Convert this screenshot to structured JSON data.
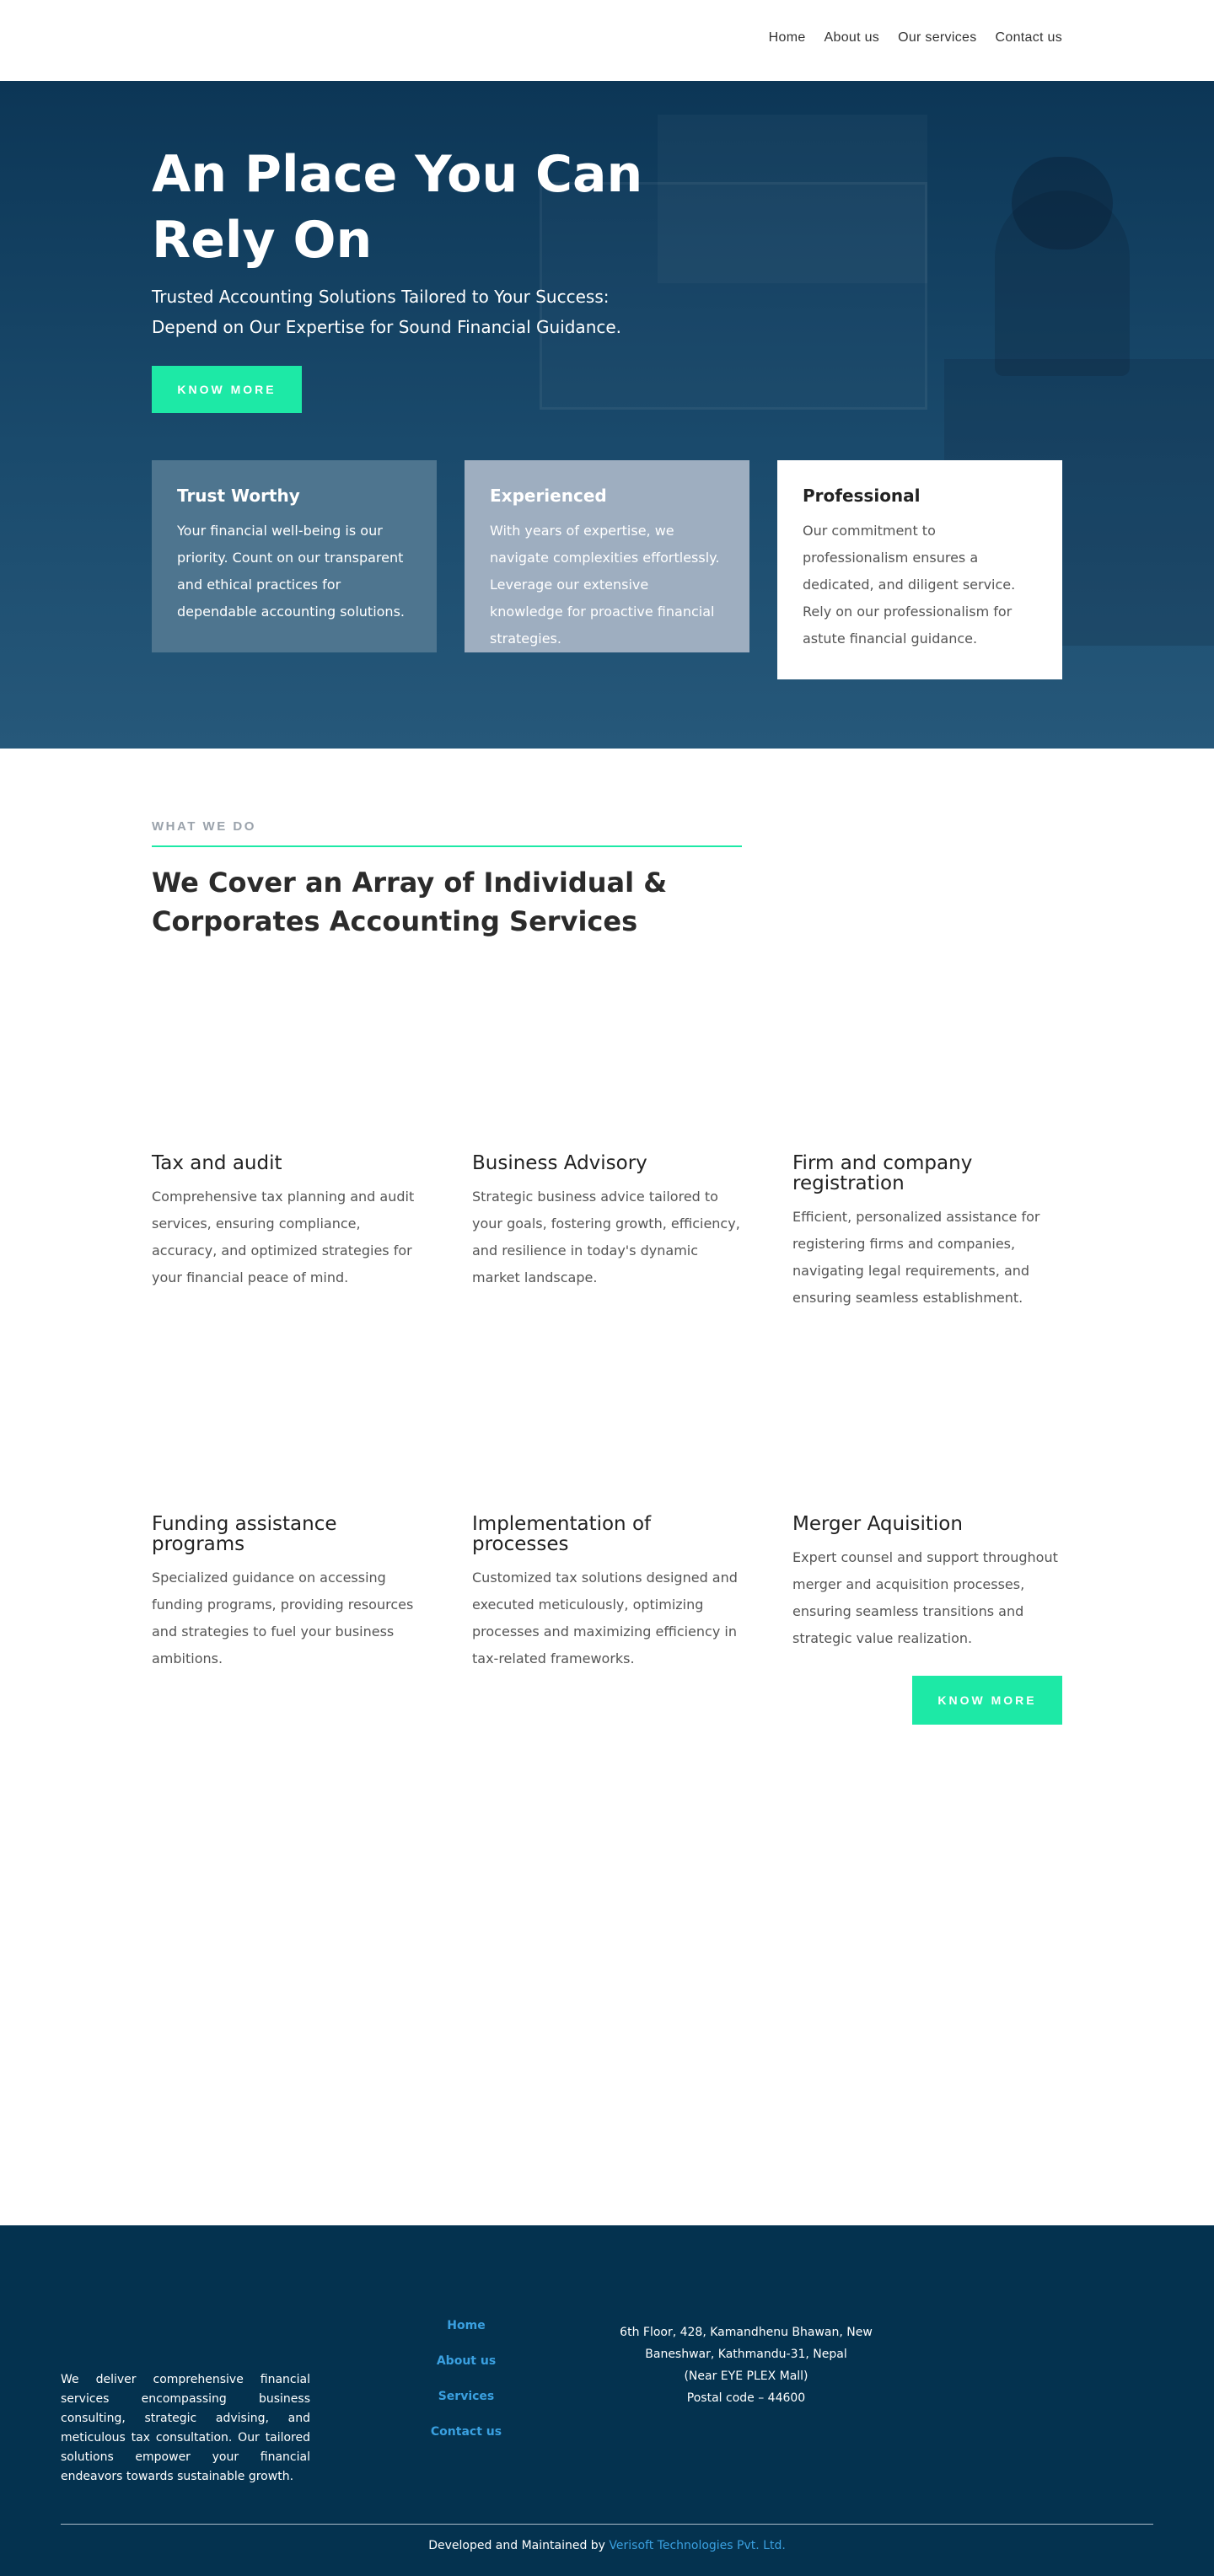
{
  "nav": {
    "items": [
      "Home",
      "About us",
      "Our services",
      "Contact us"
    ]
  },
  "hero": {
    "title": "An Place You Can Rely On",
    "subtitle": "Trusted Accounting Solutions Tailored to Your Success: Depend on Our Expertise for Sound Financial Guidance.",
    "button_label": "KNOW MORE",
    "cards": [
      {
        "title": "Trust Worthy",
        "text": "Your financial well-being is our priority. Count on our transparent and ethical practices for dependable accounting solutions."
      },
      {
        "title": "Experienced",
        "text": "With years of expertise, we navigate complexities effortlessly. Leverage our extensive knowledge for proactive financial strategies."
      },
      {
        "title": "Professional",
        "text": "Our commitment to professionalism ensures a dedicated, and diligent service. Rely on our professionalism for astute financial guidance."
      }
    ]
  },
  "services": {
    "eyebrow": "WHAT WE DO",
    "title": "We Cover an Array of Individual & Corporates Accounting Services",
    "items": [
      {
        "title": "Tax and audit",
        "text": "Comprehensive tax planning and audit services, ensuring compliance, accuracy, and optimized strategies for your financial peace of mind."
      },
      {
        "title": "Business Advisory",
        "text": "Strategic business advice tailored to your goals, fostering growth, efficiency, and resilience in today's dynamic market landscape."
      },
      {
        "title": "Firm and company registration",
        "text": "Efficient, personalized assistance for registering firms and companies, navigating legal requirements, and ensuring seamless establishment."
      },
      {
        "title": "Funding assistance programs",
        "text": "Specialized guidance on accessing funding programs, providing resources and strategies to fuel your business ambitions."
      },
      {
        "title": "Implementation of processes",
        "text": "Customized tax solutions designed and executed meticulously, optimizing processes and maximizing efficiency in tax-related frameworks."
      },
      {
        "title": "Merger Aquisition",
        "text": "Expert counsel and support throughout merger and acquisition processes, ensuring seamless transitions and strategic value realization."
      }
    ],
    "button_label": "KNOW MORE"
  },
  "footer": {
    "about": "We deliver comprehensive financial services encompassing business consulting, strategic advising, and meticulous tax consultation. Our tailored solutions empower your financial endeavors towards sustainable growth.",
    "links": [
      "Home",
      "About us",
      "Services",
      "Contact us"
    ],
    "address": {
      "line1": "6th Floor, 428, Kamandhenu Bhawan, New Baneshwar, Kathmandu-31, Nepal",
      "line2": "(Near EYE PLEX Mall)",
      "line3": "Postal code – 44600"
    },
    "credit_prefix": "Developed and Maintained by",
    "credit_company": "Verisoft Technologies Pvt. Ltd."
  },
  "colors": {
    "accent": "#1de9a6",
    "hero_dark": "#0c3656",
    "footer_bg": "#04324f",
    "link_blue": "#3aa0e0"
  }
}
